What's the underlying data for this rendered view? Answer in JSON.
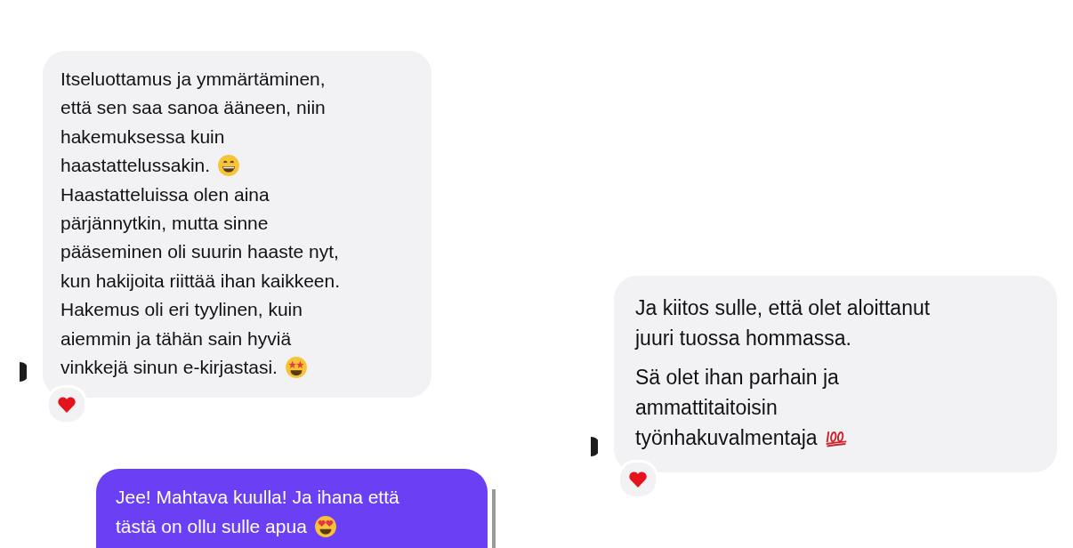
{
  "panels": [
    {
      "messages": [
        {
          "kind": "received",
          "reaction": {
            "kind": "heart"
          },
          "paragraphs": [
            {
              "lines": [
                {
                  "text": "Itseluottamus ja ymmärtäminen,"
                },
                {
                  "text": "että sen saa sanoa ääneen, niin"
                },
                {
                  "text": "hakemuksessa kuin"
                },
                {
                  "text": "haastattelussakin.",
                  "emoji": {
                    "kind": "grin"
                  }
                },
                {
                  "text": "Haastatteluissa olen aina"
                },
                {
                  "text": "pärjännytkin, mutta sinne"
                },
                {
                  "text": "pääseminen oli suurin haaste nyt,"
                },
                {
                  "text": "kun hakijoita riittää ihan kaikkeen."
                },
                {
                  "text": "Hakemus oli eri tyylinen, kuin"
                },
                {
                  "text": "aiemmin ja tähän sain hyviä"
                },
                {
                  "text": "vinkkejä sinun e-kirjastasi.",
                  "emoji": {
                    "kind": "starstruck"
                  }
                }
              ]
            }
          ]
        },
        {
          "kind": "sent",
          "paragraphs": [
            {
              "lines": [
                {
                  "text": "Jee! Mahtava kuulla! Ja ihana että"
                },
                {
                  "text": "tästä on ollu sulle apua",
                  "emoji": {
                    "kind": "hearteyes"
                  }
                }
              ]
            }
          ]
        }
      ]
    },
    {
      "messages": [
        {
          "kind": "received",
          "reaction": {
            "kind": "heart"
          },
          "paragraphs": [
            {
              "lines": [
                {
                  "text": "Ja kiitos sulle, että olet aloittanut"
                },
                {
                  "text": "juuri tuossa hommassa."
                }
              ]
            },
            {
              "lines": [
                {
                  "text": "Sä olet ihan parhain ja"
                },
                {
                  "text": "ammattitaitoisin"
                },
                {
                  "text": "työnhakuvalmentaja",
                  "emoji": {
                    "kind": "hundred"
                  }
                }
              ]
            }
          ]
        }
      ]
    }
  ]
}
